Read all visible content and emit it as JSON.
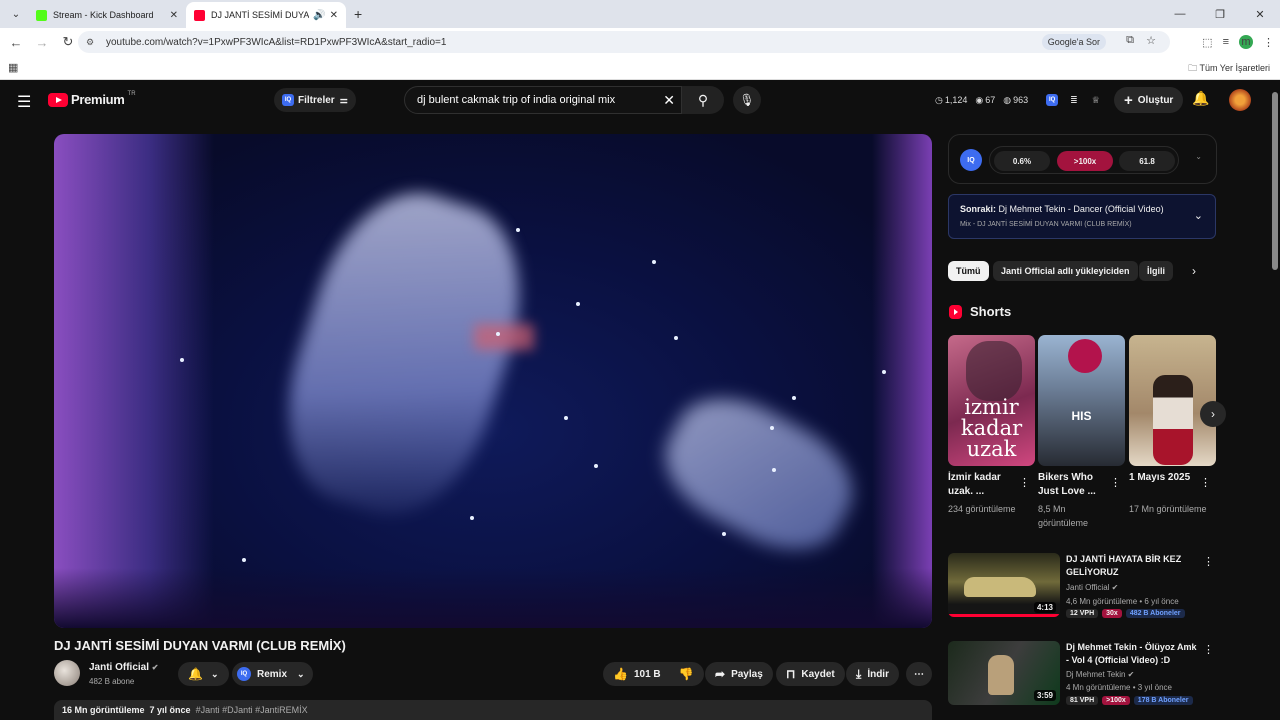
{
  "browser": {
    "tabs": [
      {
        "title": "Stream - Kick Dashboard",
        "active": false
      },
      {
        "title": "DJ JANTİ SESİMİ DUYAN VA",
        "active": true
      }
    ],
    "url": "youtube.com/watch?v=1PxwPF3WIcA&list=RD1PxwPF3WIcA&start_radio=1",
    "google_sor": "Google'a Sor",
    "profile_letter": "m",
    "bookmarks_all": "Tüm Yer İşaretleri"
  },
  "header": {
    "logo_text": "Premium",
    "logo_region": "TR",
    "filter_label": "Filtreler",
    "search_value": "dj bulent cakmak trip of india original mix",
    "stats": [
      "1,124",
      "67",
      "963"
    ],
    "create_label": "Oluştur"
  },
  "video": {
    "title": "DJ JANTİ SESİMİ DUYAN VARMI (CLUB REMİX)",
    "channel": "Janti Official",
    "subscribers": "482 B abone",
    "remix_label": "Remix",
    "likes": "101 B",
    "share_label": "Paylaş",
    "save_label": "Kaydet",
    "download_label": "İndir",
    "views": "16 Mn görüntüleme",
    "age": "7 yıl önce",
    "tags": "#Janti #DJanti #JantiREMİX"
  },
  "iq": {
    "badge": "IQ",
    "values": [
      "0.6%",
      ">100x",
      "61.8"
    ]
  },
  "up_next": {
    "label": "Sonraki:",
    "title": "Dj Mehmet Tekin - Dancer (Official Video)",
    "mix": "Mix - DJ JANTİ SESİMİ DUYAN VARMI (CLUB REMİX)"
  },
  "chips": [
    "Tümü",
    "Janti Official adlı yükleyiciden",
    "İlgili"
  ],
  "shorts": {
    "heading": "Shorts",
    "items": [
      {
        "title": "İzmir kadar uzak. ...",
        "views": "234 görüntüleme",
        "overlay": "izmir kadar uzak"
      },
      {
        "title": "Bikers Who Just Love ...",
        "views": "8,5 Mn görüntüleme",
        "overlay": "HIS"
      },
      {
        "title": "1 Mayıs 2025",
        "views": "17 Mn görüntüleme",
        "overlay": ""
      }
    ]
  },
  "recommendations": [
    {
      "title": "DJ JANTİ HAYATA BİR KEZ GELİYORUZ",
      "channel": "Janti Official",
      "meta": "4,6 Mn görüntüleme • 6 yıl önce",
      "duration": "4:13",
      "tags": [
        "12 VPH",
        "30x",
        "482 B Aboneler"
      ]
    },
    {
      "title": "Dj Mehmet Tekin - Ölüyoz Amk - Vol 4 (Official Video) :D",
      "channel": "Dj Mehmet Tekin",
      "meta": "4 Mn görüntüleme • 3 yıl önce",
      "duration": "3:59",
      "tags": [
        "81 VPH",
        ">100x",
        "178 B Aboneler"
      ]
    }
  ],
  "colors": {
    "accent": "#ff0033",
    "iq_blue": "#3d6cf0",
    "iq_pink": "#a3133e"
  }
}
